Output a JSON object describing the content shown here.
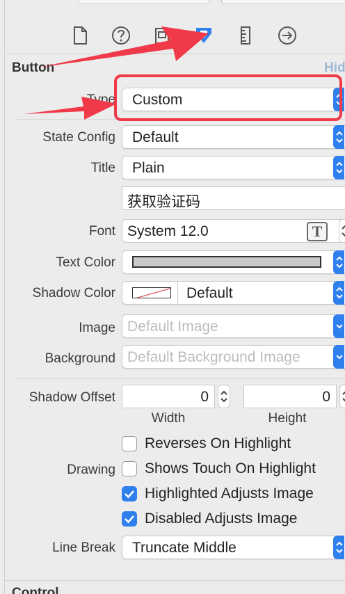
{
  "section": {
    "title": "Button",
    "hint": "Hid"
  },
  "toolbar": {
    "icons": [
      "file-icon",
      "help-icon",
      "identity-icon",
      "attributes-icon",
      "size-ruler-icon",
      "connections-icon"
    ]
  },
  "fields": {
    "type": {
      "label": "Type",
      "value": "Custom"
    },
    "state_config": {
      "label": "State Config",
      "value": "Default"
    },
    "title": {
      "label": "Title",
      "value": "Plain",
      "text": "获取验证码"
    },
    "font": {
      "label": "Font",
      "value": "System 12.0",
      "t_glyph": "T"
    },
    "text_color": {
      "label": "Text Color",
      "swatch": "#c9c9c9"
    },
    "shadow_color": {
      "label": "Shadow Color",
      "value": "Default"
    },
    "image": {
      "label": "Image",
      "placeholder": "Default Image"
    },
    "background": {
      "label": "Background",
      "placeholder": "Default Background Image"
    },
    "shadow_offset": {
      "label": "Shadow Offset",
      "width": "0",
      "height": "0",
      "width_label": "Width",
      "height_label": "Height"
    },
    "drawing": {
      "label": "Drawing",
      "options": [
        {
          "label": "Reverses On Highlight",
          "checked": false
        },
        {
          "label": "Shows Touch On Highlight",
          "checked": false
        },
        {
          "label": "Highlighted Adjusts Image",
          "checked": true
        },
        {
          "label": "Disabled Adjusts Image",
          "checked": true
        }
      ]
    },
    "line_break": {
      "label": "Line Break",
      "value": "Truncate Middle"
    }
  },
  "next_section": {
    "title": "Control"
  },
  "colors": {
    "accent": "#2f80ed",
    "annotation": "#f03a4a"
  }
}
